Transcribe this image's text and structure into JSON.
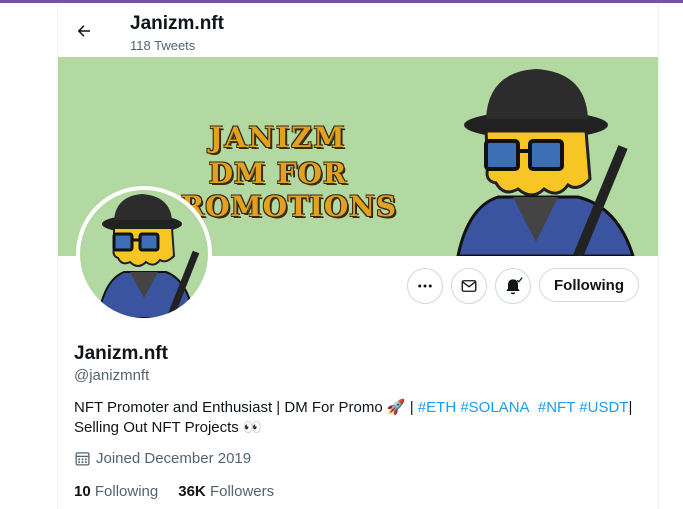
{
  "header": {
    "title": "Janizm.nft",
    "tweet_count": "118 Tweets"
  },
  "banner": {
    "line1": "JANIZM",
    "line2": "DM FOR PROMOTIONS"
  },
  "profile": {
    "name": "Janizm.nft",
    "handle": "@janizmnft",
    "bio_prefix": "NFT Promoter and Enthusiast | DM For Promo ",
    "bio_rocket": "🚀",
    "bio_sep": " | ",
    "hashtags": [
      "#ETH",
      "#SOLANA",
      "#NFT",
      "#USDT"
    ],
    "bio_suffix": "|",
    "bio_line2": "Selling Out NFT Projects ",
    "bio_eyes": "👀",
    "joined": "Joined December 2019"
  },
  "stats": {
    "following_count": "10",
    "following_label": "Following",
    "followers_count": "36K",
    "followers_label": "Followers"
  },
  "actions": {
    "follow_button": "Following"
  },
  "colors": {
    "accent": "#1d9bf0",
    "banner_bg": "#b3d9a3",
    "banner_text": "#e2a11f",
    "top_accent": "#7b4fa8"
  }
}
